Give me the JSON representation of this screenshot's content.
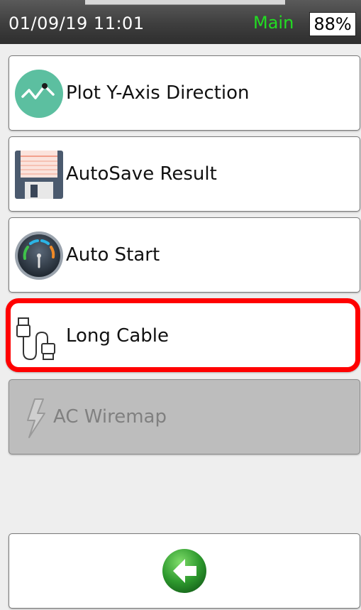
{
  "status_bar": {
    "datetime": "01/09/19 11:01",
    "mode": "Main",
    "battery": "88%"
  },
  "menu": {
    "items": [
      {
        "label": "Plot Y-Axis Direction",
        "icon": "plot-waveform-icon",
        "enabled": true,
        "highlighted": false
      },
      {
        "label": "AutoSave Result",
        "icon": "floppy-disk-icon",
        "enabled": true,
        "highlighted": false
      },
      {
        "label": "Auto Start",
        "icon": "gauge-icon",
        "enabled": true,
        "highlighted": false
      },
      {
        "label": "Long Cable",
        "icon": "cable-plug-icon",
        "enabled": true,
        "highlighted": true
      },
      {
        "label": "AC Wiremap",
        "icon": "lightning-bolt-icon",
        "enabled": false,
        "highlighted": false
      }
    ]
  },
  "back_button": {
    "icon": "back-arrow-icon"
  },
  "colors": {
    "mode_text": "#22dd22",
    "highlight_border": "#ff0000",
    "disabled_bg": "#bdbdbd",
    "plot_icon": "#5cbfa0",
    "back_arrow": "#2e9a2e"
  }
}
